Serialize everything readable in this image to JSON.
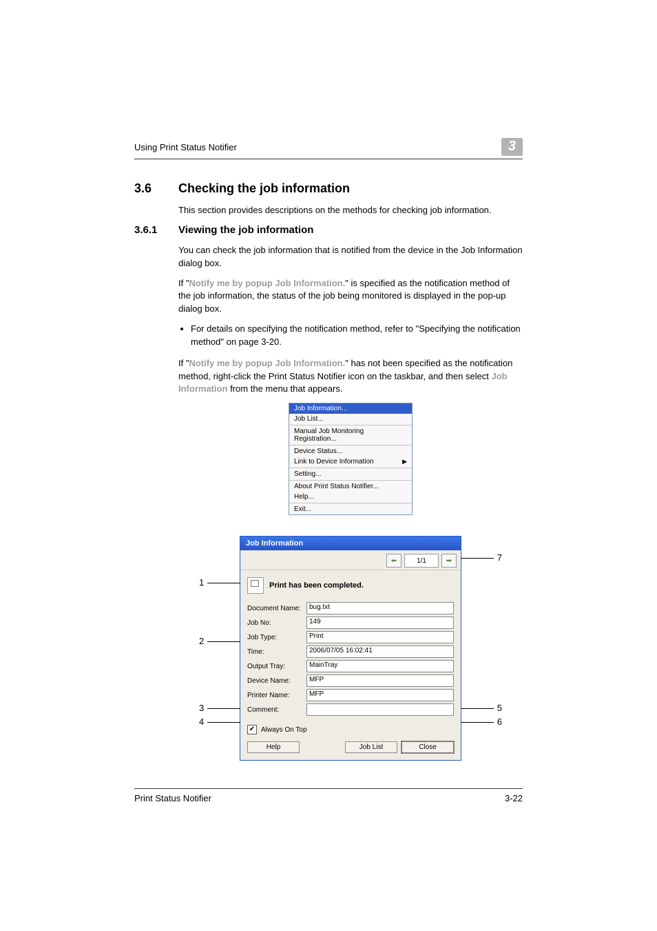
{
  "header": {
    "running": "Using Print Status Notifier",
    "chapter": "3"
  },
  "section": {
    "num": "3.6",
    "title": "Checking the job information"
  },
  "intro": "This section provides descriptions on the methods for checking job information.",
  "subsection": {
    "num": "3.6.1",
    "title": "Viewing the job information"
  },
  "p1": "You can check the job information that is notified from the device in the Job Information dialog box.",
  "p2_pre": "If \"",
  "p2_bold": "Notify me by popup Job Information.",
  "p2_post": "\" is specified as the notification method of the job information, the status of the job being monitored is displayed in the pop-up dialog box.",
  "bullet": "For details on specifying the notification method, refer to \"Specifying the notification method\" on page 3-20.",
  "p3_pre": "If \"",
  "p3_bold": "Notify me by popup Job Information.",
  "p3_mid": "\" has not been specified as the notification method, right-click the Print Status Notifier icon on the taskbar, and then select ",
  "p3_bold2": "Job Information",
  "p3_post": " from the menu that appears.",
  "menu": {
    "items": [
      "Job Information...",
      "Job List...",
      "Manual Job Monitoring Registration...",
      "Device Status...",
      "Link to Device Information",
      "Setting...",
      "About Print Status Notifier...",
      "Help...",
      "Exit..."
    ]
  },
  "dialog": {
    "title": "Job Information",
    "page": "1/1",
    "status": "Print has been completed.",
    "fields": [
      {
        "label": "Document Name:",
        "value": "bug.txt"
      },
      {
        "label": "Job No:",
        "value": "149"
      },
      {
        "label": "Job Type:",
        "value": "Print"
      },
      {
        "label": "Time:",
        "value": "2006/07/05 16:02:41"
      },
      {
        "label": "Output Tray:",
        "value": "MainTray"
      },
      {
        "label": "Device Name:",
        "value": " MFP"
      },
      {
        "label": "Printer Name:",
        "value": "MFP"
      },
      {
        "label": "Comment:",
        "value": ""
      }
    ],
    "always_on_top": "Always On Top",
    "help": "Help",
    "job_list": "Job List",
    "close": "Close"
  },
  "callouts": {
    "c1": "1",
    "c2": "2",
    "c3": "3",
    "c4": "4",
    "c5": "5",
    "c6": "6",
    "c7": "7"
  },
  "footer": {
    "left": "Print Status Notifier",
    "right": "3-22"
  }
}
